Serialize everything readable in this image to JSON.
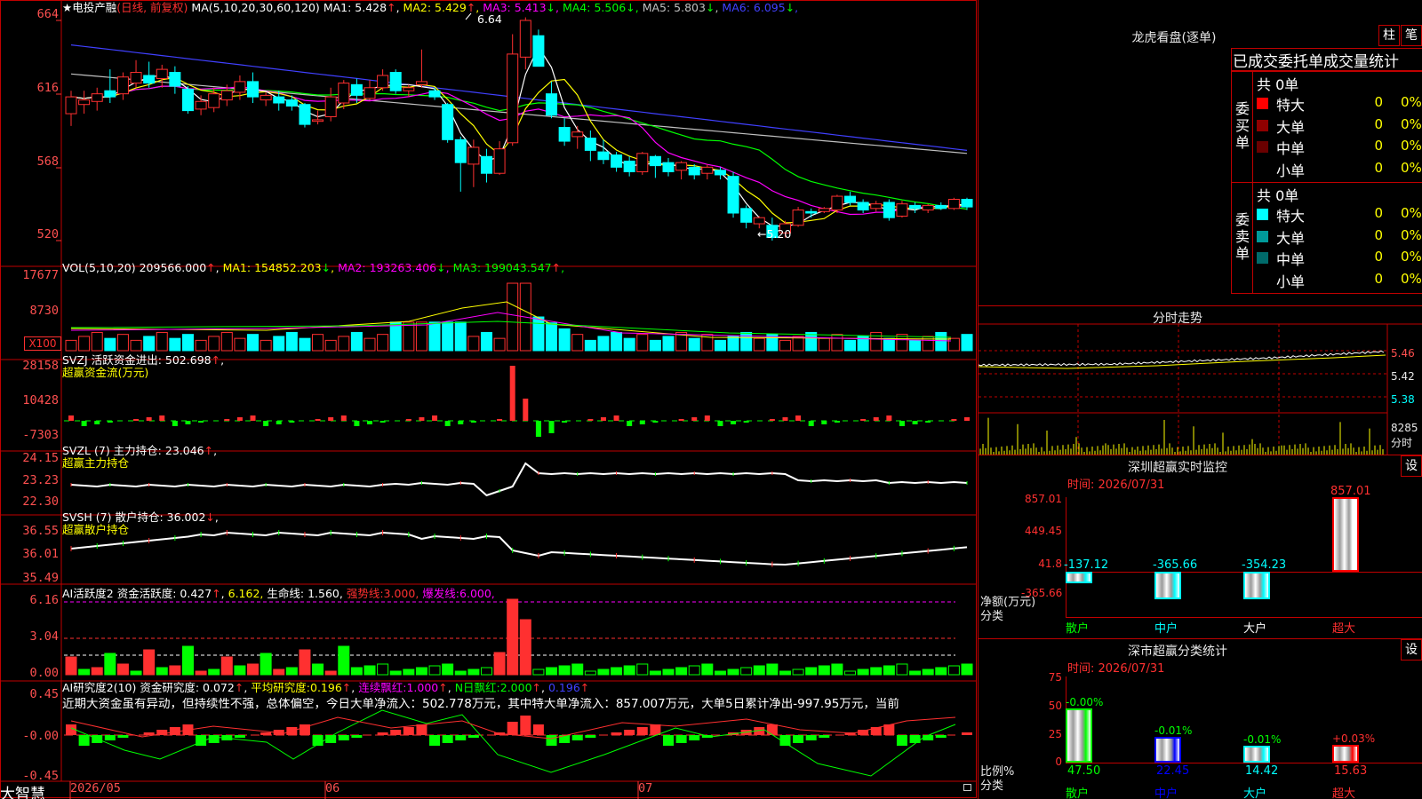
{
  "app": {
    "brand": "大智慧"
  },
  "main": {
    "stock_name": "电投产融",
    "period": "(日线, 前复权)",
    "ma_header": {
      "params": "MA(5,10,20,30,60,120)",
      "items": [
        {
          "label": "MA1:",
          "value": "5.428",
          "arrow": "↑",
          "color": "#ffffff"
        },
        {
          "label": "MA2:",
          "value": "5.429",
          "arrow": "↑",
          "color": "#ffff00"
        },
        {
          "label": "MA3:",
          "value": "5.413",
          "arrow": "↓",
          "color": "#ff00ff"
        },
        {
          "label": "MA4:",
          "value": "5.506",
          "arrow": "↓",
          "color": "#00ff00"
        },
        {
          "label": "MA5:",
          "value": "5.803",
          "arrow": "↓",
          "color": "#c0c0c0"
        },
        {
          "label": "MA6:",
          "value": "6.095",
          "arrow": "↓",
          "color": "#4040ff"
        }
      ]
    },
    "high_annot": "6.64",
    "low_annot": "←5.20",
    "price_axis": [
      "664",
      "616",
      "568",
      "520"
    ],
    "vol_header": {
      "params": "VOL(5,10,20)",
      "value": "209566.000",
      "items": [
        {
          "label": "MA1:",
          "value": "154852.203",
          "arrow": "↓",
          "color": "#ffff00"
        },
        {
          "label": "MA2:",
          "value": "193263.406",
          "arrow": "↓",
          "color": "#ff00ff"
        },
        {
          "label": "MA3:",
          "value": "199043.547",
          "arrow": "↑",
          "color": "#00ff00"
        }
      ]
    },
    "vol_axis": [
      "17677",
      "8730"
    ],
    "vol_unit": "X100",
    "svzj": {
      "label": "SVZJ  活跃资金进出:",
      "value": "502.698",
      "sub": "超赢资金流(万元)",
      "axis": [
        "28158",
        "10428",
        "-7303"
      ]
    },
    "svzl": {
      "label": "SVZL (7) 主力持仓:",
      "value": "23.046",
      "sub": "超赢主力持仓",
      "axis": [
        "24.15",
        "23.23",
        "22.30"
      ]
    },
    "svsh": {
      "label": "SVSH (7) 散户持仓:",
      "value": "36.002",
      "sub": "超赢散户持仓",
      "axis": [
        "36.55",
        "36.01",
        "35.49"
      ]
    },
    "ai_active": {
      "label": "AI活跃度2",
      "t1": "资金活跃度:",
      "v1": "0.427",
      "v2": "6.162,",
      "t3": "生命线:",
      "v3": "1.560,",
      "t4": "强势线:",
      "v4": "3.000,",
      "t5": "爆发线:",
      "v5": "6.000,",
      "axis": [
        "6.16",
        "3.04",
        "0.00"
      ]
    },
    "ai_research": {
      "label": "AI研究度2(10)",
      "t1": "资金研究度:",
      "v1": "0.072",
      "t2": "平均研究度:",
      "v2": "0.196",
      "t3": "连续飘红:",
      "v3": "1.000",
      "t4": "N日飘红:",
      "v4": "2.000",
      "v5": "0.196",
      "desc": "近期大资金虽有异动，但持续性不强，总体偏空，今日大单净流入：502.778万元，其中特大单净流入：857.007万元，大单5日累计净出-997.95万元，当前",
      "axis": [
        "0.45",
        "-0.00",
        "-0.45"
      ]
    },
    "dates": [
      "2026/05",
      "06",
      "07"
    ]
  },
  "dragon": {
    "title": "龙虎看盘(逐单)",
    "btn1": "柱",
    "btn2": "笔",
    "subtitle": "已成交委托单成交量统计",
    "buy": {
      "side": "委买单",
      "total": "共 0单",
      "rows": [
        {
          "name": "特大",
          "count": "0",
          "pct": "0%",
          "color": "#ff0000"
        },
        {
          "name": "大单",
          "count": "0",
          "pct": "0%",
          "color": "#900000"
        },
        {
          "name": "中单",
          "count": "0",
          "pct": "0%",
          "color": "#6a0000"
        },
        {
          "name": "小单",
          "count": "0",
          "pct": "0%",
          "color": "#000000"
        }
      ]
    },
    "sell": {
      "side": "委卖单",
      "total": "共 0单",
      "rows": [
        {
          "name": "特大",
          "count": "0",
          "pct": "0%",
          "color": "#00ffff"
        },
        {
          "name": "大单",
          "count": "0",
          "pct": "0%",
          "color": "#009a9a"
        },
        {
          "name": "中单",
          "count": "0",
          "pct": "0%",
          "color": "#006a6a"
        },
        {
          "name": "小单",
          "count": "0",
          "pct": "0%",
          "color": "#000000"
        }
      ]
    }
  },
  "timeshare": {
    "title": "分时走势",
    "axis": [
      "5.46",
      "5.42",
      "5.38"
    ],
    "vol_value": "8285",
    "vol_label": "分时"
  },
  "monitor": {
    "title": "深圳超赢实时监控",
    "btn": "设",
    "time": "时间: 2026/07/31",
    "axis": [
      "857.01",
      "449.45",
      "41.8",
      "-365.66"
    ],
    "unit": "净额(万元)",
    "cat_label": "分类",
    "bars": [
      {
        "name": "散户",
        "value": -137.12,
        "label": "-137.12"
      },
      {
        "name": "中户",
        "value": -365.66,
        "label": "-365.66"
      },
      {
        "name": "大户",
        "value": -354.23,
        "label": "-354.23"
      },
      {
        "name": "超大",
        "value": 857.01,
        "label": "857.01"
      }
    ]
  },
  "stats": {
    "title": "深市超赢分类统计",
    "btn": "设",
    "time": "时间: 2026/07/31",
    "axis": [
      "75",
      "50",
      "25",
      "0"
    ],
    "unit": "比例%",
    "cat_label": "分类",
    "bars": [
      {
        "name": "散户",
        "value": 47.5,
        "label": "47.50",
        "change": "-0.00%",
        "color": "#00ff00"
      },
      {
        "name": "中户",
        "value": 22.45,
        "label": "22.45",
        "change": "-0.01%",
        "color": "#0000ff"
      },
      {
        "name": "大户",
        "value": 14.42,
        "label": "14.42",
        "change": "-0.01%",
        "color": "#00ffff"
      },
      {
        "name": "超大",
        "value": 15.63,
        "label": "15.63",
        "change": "+0.03%",
        "color": "#ff0000"
      }
    ]
  },
  "chart_data": {
    "type": "candlestick",
    "x_axis": [
      "2026/05",
      "06",
      "07"
    ],
    "price_range": [
      5.15,
      6.7
    ],
    "price_ticks": [
      6.64,
      6.16,
      5.68,
      5.2
    ],
    "high": 6.64,
    "low": 5.2,
    "candles": [
      [
        6.03,
        6.14,
        6.18,
        5.95
      ],
      [
        6.09,
        6.12,
        6.18,
        6.03
      ],
      [
        6.11,
        6.16,
        6.2,
        6.05
      ],
      [
        6.18,
        6.14,
        6.32,
        6.1
      ],
      [
        6.16,
        6.27,
        6.3,
        6.12
      ],
      [
        6.23,
        6.3,
        6.38,
        6.2
      ],
      [
        6.28,
        6.23,
        6.37,
        6.2
      ],
      [
        6.26,
        6.32,
        6.35,
        6.2
      ],
      [
        6.3,
        6.21,
        6.34,
        6.16
      ],
      [
        6.19,
        6.05,
        6.21,
        6.03
      ],
      [
        6.06,
        6.11,
        6.15,
        6.02
      ],
      [
        6.07,
        6.16,
        6.2,
        6.04
      ],
      [
        6.12,
        6.18,
        6.22,
        6.08
      ],
      [
        6.17,
        6.24,
        6.28,
        6.12
      ],
      [
        6.24,
        6.14,
        6.3,
        6.1
      ],
      [
        6.12,
        6.15,
        6.17,
        6.08
      ],
      [
        6.14,
        6.1,
        6.18,
        6.05
      ],
      [
        6.12,
        6.08,
        6.15,
        6.05
      ],
      [
        6.09,
        5.96,
        6.1,
        5.94
      ],
      [
        5.98,
        5.99,
        6.05,
        5.96
      ],
      [
        6.01,
        6.14,
        6.2,
        5.98
      ],
      [
        6.1,
        6.23,
        6.25,
        6.06
      ],
      [
        6.22,
        6.15,
        6.26,
        6.1
      ],
      [
        6.13,
        6.2,
        6.25,
        6.12
      ],
      [
        6.2,
        6.28,
        6.32,
        6.18
      ],
      [
        6.3,
        6.18,
        6.32,
        6.16
      ],
      [
        6.18,
        6.2,
        6.22,
        6.14
      ],
      [
        6.22,
        6.24,
        6.45,
        6.2
      ],
      [
        6.18,
        6.14,
        6.2,
        6.12
      ],
      [
        6.09,
        5.86,
        6.1,
        5.84
      ],
      [
        5.86,
        5.71,
        5.88,
        5.52
      ],
      [
        5.7,
        5.81,
        5.86,
        5.55
      ],
      [
        5.75,
        5.64,
        5.8,
        5.58
      ],
      [
        5.64,
        5.8,
        5.85,
        5.63
      ],
      [
        5.84,
        6.42,
        6.55,
        5.82
      ],
      [
        6.4,
        6.64,
        6.66,
        6.32
      ],
      [
        6.54,
        6.34,
        6.58,
        6.34
      ],
      [
        6.16,
        6.02,
        6.24,
        6.0
      ],
      [
        5.94,
        5.85,
        6.0,
        5.82
      ],
      [
        5.88,
        5.91,
        5.95,
        5.8
      ],
      [
        5.87,
        5.79,
        5.92,
        5.72
      ],
      [
        5.78,
        5.73,
        5.86,
        5.7
      ],
      [
        5.76,
        5.68,
        5.78,
        5.65
      ],
      [
        5.72,
        5.65,
        5.75,
        5.62
      ],
      [
        5.65,
        5.77,
        5.78,
        5.63
      ],
      [
        5.75,
        5.69,
        5.76,
        5.61
      ],
      [
        5.71,
        5.65,
        5.74,
        5.62
      ],
      [
        5.66,
        5.71,
        5.72,
        5.6
      ],
      [
        5.68,
        5.63,
        5.7,
        5.6
      ],
      [
        5.64,
        5.68,
        5.7,
        5.6
      ],
      [
        5.66,
        5.63,
        5.68,
        5.6
      ],
      [
        5.62,
        5.38,
        5.65,
        5.35
      ],
      [
        5.41,
        5.32,
        5.43,
        5.28
      ],
      [
        5.31,
        5.35,
        5.36,
        5.28
      ],
      [
        5.3,
        5.22,
        5.35,
        5.2
      ],
      [
        5.25,
        5.31,
        5.33,
        5.22
      ],
      [
        5.3,
        5.4,
        5.42,
        5.29
      ],
      [
        5.39,
        5.38,
        5.41,
        5.35
      ],
      [
        5.39,
        5.41,
        5.42,
        5.38
      ],
      [
        5.4,
        5.49,
        5.5,
        5.38
      ],
      [
        5.49,
        5.45,
        5.52,
        5.43
      ],
      [
        5.45,
        5.4,
        5.47,
        5.38
      ],
      [
        5.41,
        5.44,
        5.46,
        5.39
      ],
      [
        5.45,
        5.35,
        5.47,
        5.33
      ],
      [
        5.36,
        5.44,
        5.46,
        5.35
      ],
      [
        5.43,
        5.41,
        5.45,
        5.38
      ],
      [
        5.4,
        5.43,
        5.44,
        5.38
      ],
      [
        5.43,
        5.41,
        5.45,
        5.4
      ],
      [
        5.41,
        5.47,
        5.48,
        5.4
      ],
      [
        5.47,
        5.42,
        5.48,
        5.4
      ]
    ],
    "volume_ticks": [
      17677,
      8730
    ],
    "fund_flow_ticks": [
      28158,
      10428,
      -7303
    ],
    "main_position_ticks": [
      24.15,
      23.23,
      22.3
    ],
    "retail_position_ticks": [
      36.55,
      36.01,
      35.49
    ],
    "activity_ticks": [
      6.16,
      3.04,
      0.0
    ],
    "research_ticks": [
      0.45,
      -0.0,
      -0.45
    ]
  }
}
